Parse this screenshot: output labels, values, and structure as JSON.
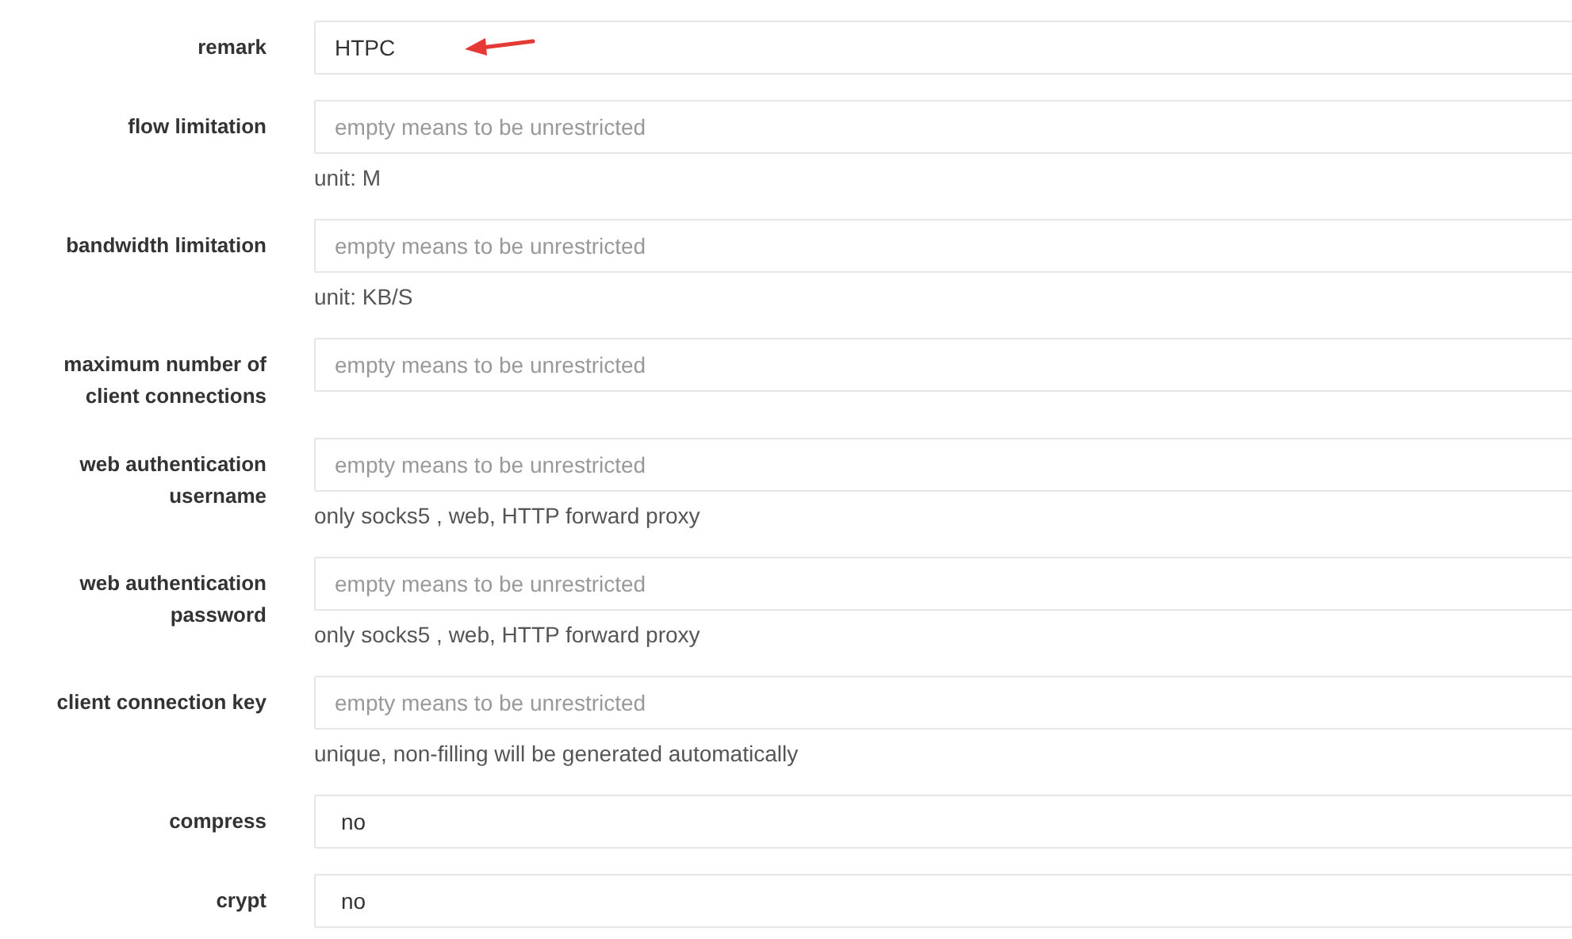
{
  "fields": [
    {
      "label": "remark",
      "kind": "text",
      "value": "HTPC",
      "marked": true
    },
    {
      "label": "flow limitation",
      "kind": "text",
      "placeholder": "empty means to be unrestricted",
      "help": "unit: M"
    },
    {
      "label": "bandwidth limitation",
      "kind": "text",
      "placeholder": "empty means to be unrestricted",
      "help": "unit: KB/S"
    },
    {
      "label": "maximum number of client connections",
      "kind": "text",
      "placeholder": "empty means to be unrestricted"
    },
    {
      "label": "web authentication username",
      "kind": "text",
      "placeholder": "empty means to be unrestricted",
      "help": "only socks5 , web, HTTP forward proxy"
    },
    {
      "label": "web authentication password",
      "kind": "text",
      "placeholder": "empty means to be unrestricted",
      "help": "only socks5 , web, HTTP forward proxy"
    },
    {
      "label": "client connection key",
      "kind": "text",
      "placeholder": "empty means to be unrestricted",
      "help": "unique, non-filling will be generated automatically"
    },
    {
      "label": "compress",
      "kind": "select",
      "value": "no"
    },
    {
      "label": "crypt",
      "kind": "select",
      "value": "no"
    }
  ]
}
